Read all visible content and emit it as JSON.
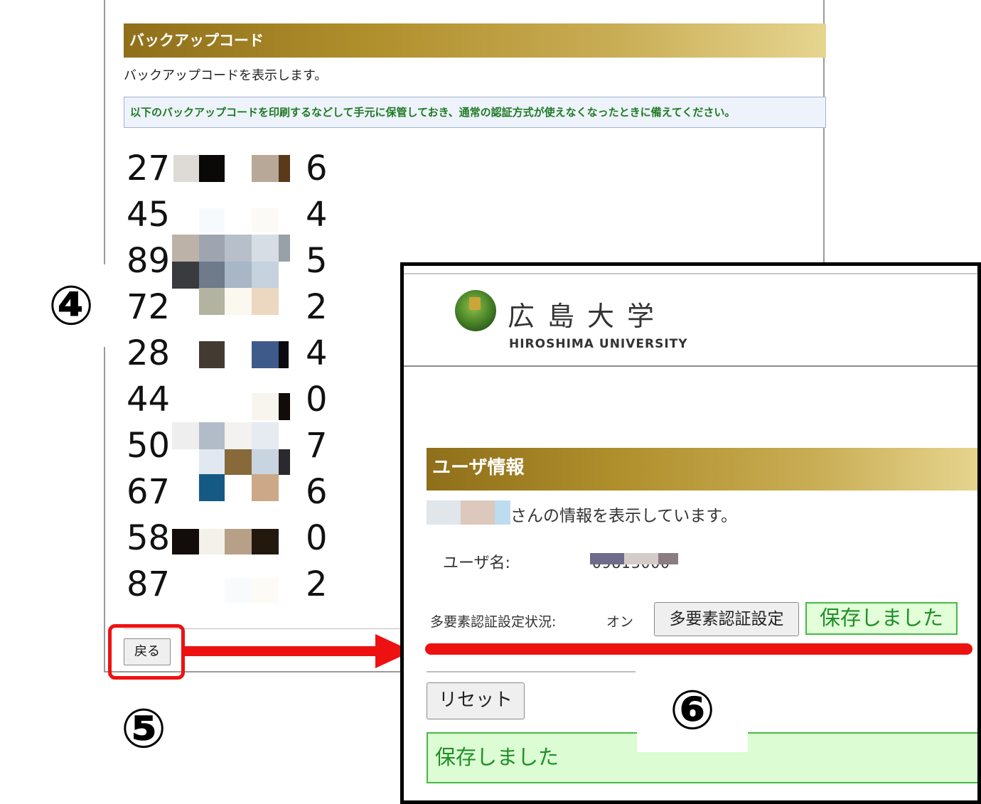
{
  "backup": {
    "header": "バックアップコード",
    "description": "バックアップコードを表示します。",
    "notice": "以下のバックアップコードを印刷するなどして手元に保管しておき、通常の認証方式が使えなくなったときに備えてください。",
    "codes": [
      {
        "prefix": "27",
        "suffix": "6"
      },
      {
        "prefix": "45",
        "suffix": "4"
      },
      {
        "prefix": "89",
        "suffix": "5"
      },
      {
        "prefix": "72",
        "suffix": "2"
      },
      {
        "prefix": "28",
        "suffix": "4"
      },
      {
        "prefix": "44",
        "suffix": "0"
      },
      {
        "prefix": "50",
        "suffix": "7"
      },
      {
        "prefix": "67",
        "suffix": "6"
      },
      {
        "prefix": "58",
        "suffix": "0"
      },
      {
        "prefix": "87",
        "suffix": "2"
      }
    ],
    "back_label": "戻る"
  },
  "callouts": {
    "four": "④",
    "five": "⑤",
    "six": "⑥"
  },
  "user": {
    "logo_jp": "広島大学",
    "logo_en": "HIROSHIMA UNIVERSITY",
    "header": "ユーザ情報",
    "description": "さんの情報を表示しています。",
    "username_label": "ユーザ名:",
    "username_value": "09813000",
    "mfa_label": "多要素認証設定状況:",
    "mfa_status": "オン",
    "mfa_button": "多要素認証設定",
    "saved_badge": "保存しました",
    "reset_button": "リセット",
    "saved_banner": "保存しました"
  },
  "colors": {
    "accent_red": "#ee1111",
    "gold_dark": "#8f6f1a",
    "gold_light": "#e6d58f",
    "success_green": "#1f8f28",
    "success_bg": "#dcfcd3"
  }
}
